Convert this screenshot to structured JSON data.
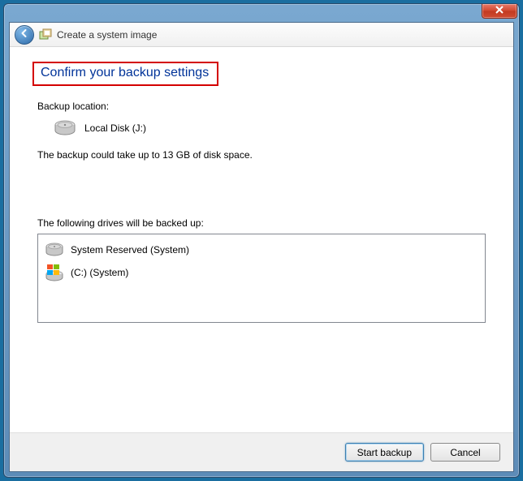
{
  "header": {
    "title": "Create a system image"
  },
  "page": {
    "heading": "Confirm your backup settings",
    "backup_location_label": "Backup location:",
    "backup_location_value": "Local Disk (J:)",
    "size_note": "The backup could take up to 13 GB of disk space.",
    "drives_label": "The following drives will be backed up:",
    "drives": [
      {
        "label": "System Reserved (System)"
      },
      {
        "label": "(C:) (System)"
      }
    ]
  },
  "buttons": {
    "start": "Start backup",
    "cancel": "Cancel"
  }
}
